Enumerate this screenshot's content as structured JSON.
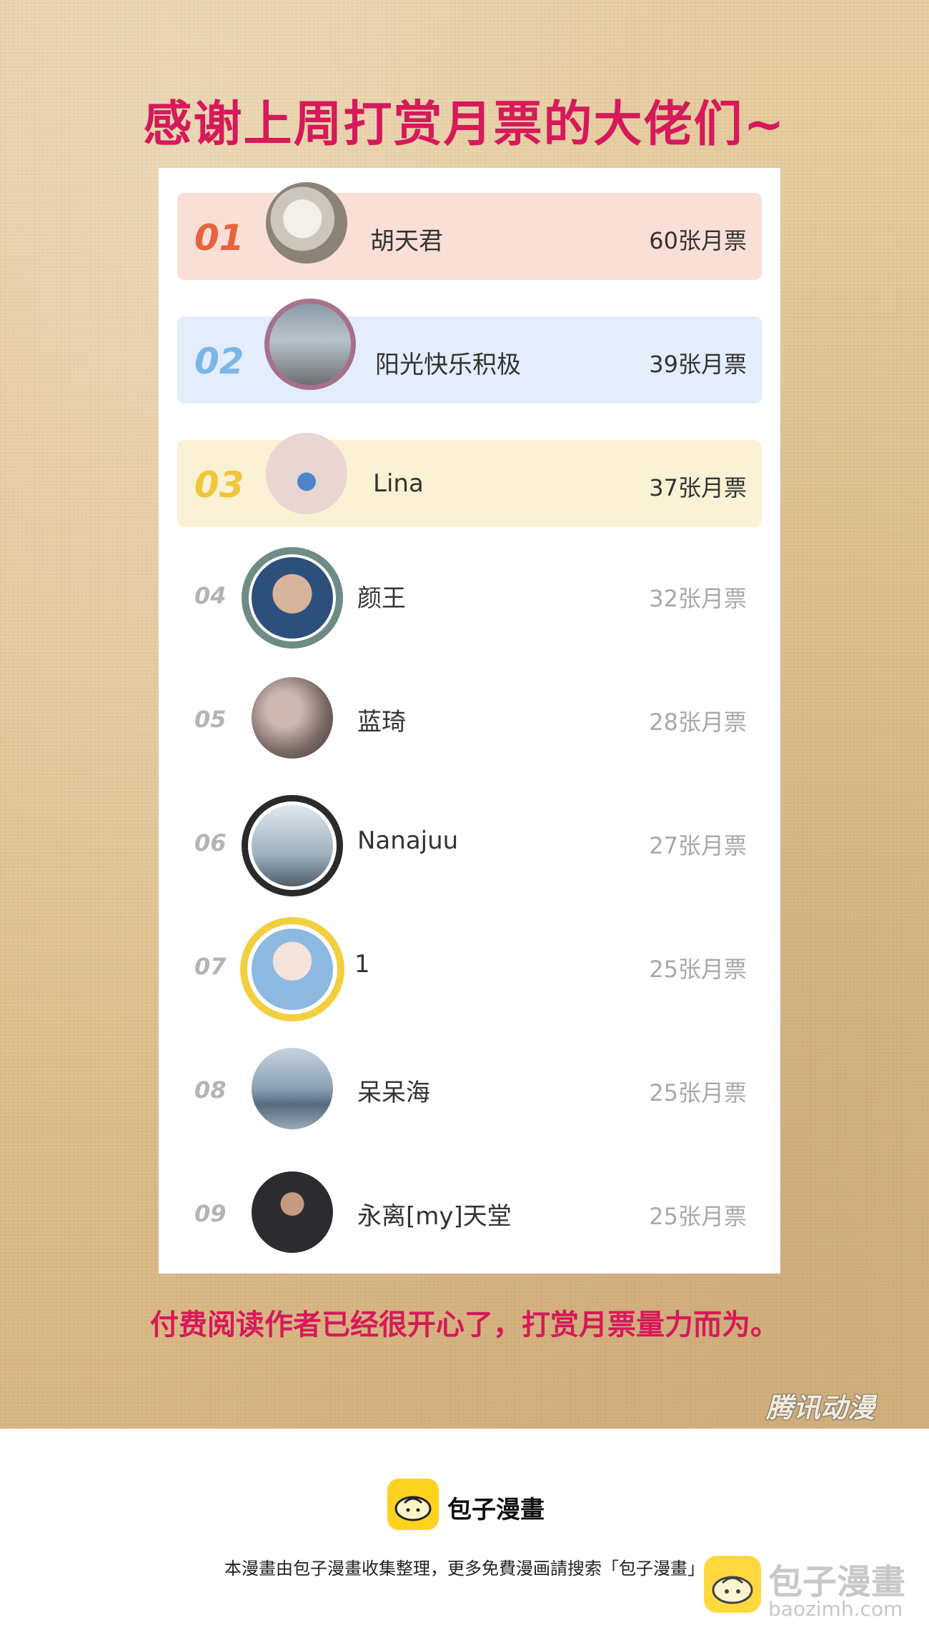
{
  "title": "感谢上周打赏月票的大佬们~",
  "bottom_note": "付费阅读作者已经很开心了，打赏月票量力而为。",
  "ranking": [
    {
      "rank": "01",
      "name": "胡天君",
      "votes": "60张月票"
    },
    {
      "rank": "02",
      "name": "阳光快乐积极",
      "votes": "39张月票"
    },
    {
      "rank": "03",
      "name": "Lina",
      "votes": "37张月票"
    },
    {
      "rank": "04",
      "name": "颜王",
      "votes": "32张月票"
    },
    {
      "rank": "05",
      "name": "蓝琦",
      "votes": "28张月票"
    },
    {
      "rank": "06",
      "name": "Nanajuu",
      "votes": "27张月票"
    },
    {
      "rank": "07",
      "name": "1",
      "votes": "25张月票"
    },
    {
      "rank": "08",
      "name": "呆呆海",
      "votes": "25张月票"
    },
    {
      "rank": "09",
      "name": "永离[my]天堂",
      "votes": "25张月票"
    }
  ],
  "watermark": "腾讯动漫",
  "footer": {
    "brand": "包子漫畫",
    "text": "本漫畫由包子漫畫收集整理，更多免費漫画請搜索「包子漫畫」",
    "corner_brand": "包子漫畫",
    "corner_url": "baozimh.com"
  },
  "colors": {
    "title": "#d6195a",
    "rank1": "#e8623c",
    "rank2": "#7ab7e8",
    "rank3": "#f0c63a"
  }
}
